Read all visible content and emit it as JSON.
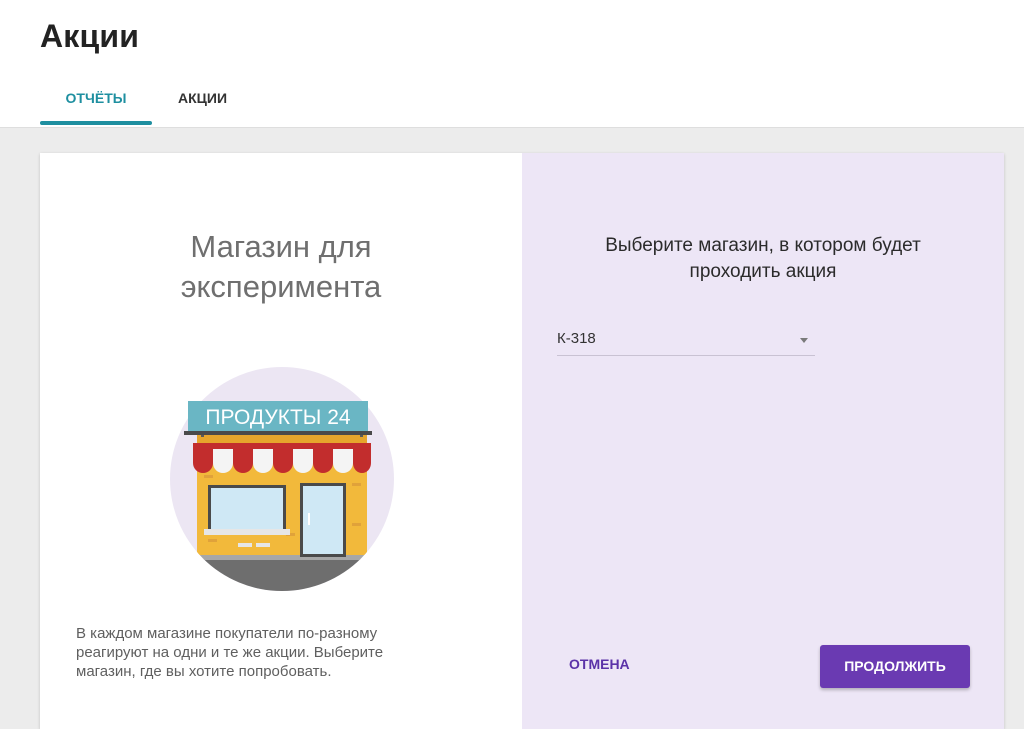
{
  "header": {
    "title": "Акции",
    "tabs": [
      {
        "label": "ОТЧЁТЫ",
        "active": true
      },
      {
        "label": "АКЦИИ",
        "active": false
      }
    ],
    "accent_color": "#1e8fa0"
  },
  "left_panel": {
    "title_line1": "Магазин для",
    "title_line2": "эксперимента",
    "illustration": {
      "icon": "store-front-icon",
      "sign_text": "ПРОДУКТЫ 24"
    },
    "description_line1": "В каждом магазине покупатели по-разному",
    "description_line2": "реагируют на одни и те же акции. Выберите",
    "description_line3": "магазин, где вы хотите попробовать."
  },
  "right_panel": {
    "title_line1": "Выберите магазин, в котором будет",
    "title_line2": "проходить акция",
    "store_select": {
      "value": "К-318"
    },
    "cancel_label": "ОТМЕНА",
    "continue_label": "ПРОДОЛЖИТЬ",
    "primary_color": "#6a3ab2",
    "background_color": "#ede6f6"
  }
}
